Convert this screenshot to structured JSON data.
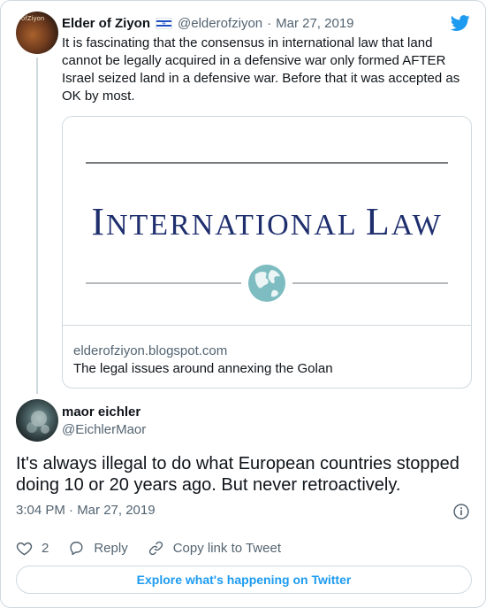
{
  "parent_tweet": {
    "author_name": "Elder of Ziyon",
    "flag_icon": "israel-flag-icon",
    "handle": "@elderofziyon",
    "separator": "·",
    "date": "Mar 27, 2019",
    "avatar_caption": "ofZiyon",
    "text": "It is fascinating that the consensus in international law that land cannot be legally acquired in a defensive war only formed AFTER Israel seized land in a defensive war. Before that it was accepted as OK by most.",
    "link_card": {
      "image_title_first": "I",
      "image_title_rest1": "NTERNATIONAL ",
      "image_title_cap2": "L",
      "image_title_rest2": "AW",
      "domain": "elderofziyon.blogspot.com",
      "description": "The legal issues around annexing the Golan"
    }
  },
  "reply_tweet": {
    "author_name": "maor eichler",
    "handle": "@EichlerMaor",
    "text": "It's always illegal to do what European countries stopped doing 10 or 20 years ago. But never retroactively.",
    "timestamp": "3:04 PM · Mar 27, 2019"
  },
  "actions": {
    "like_count": "2",
    "reply_label": "Reply",
    "copy_link_label": "Copy link to Tweet"
  },
  "explore_label": "Explore what's happening on Twitter",
  "colors": {
    "accent": "#1d9bf0",
    "muted": "#536471",
    "border": "#cfd9de",
    "text": "#0f1419",
    "logo_navy": "#1f2f6e",
    "globe_teal": "#6fb3b8"
  }
}
